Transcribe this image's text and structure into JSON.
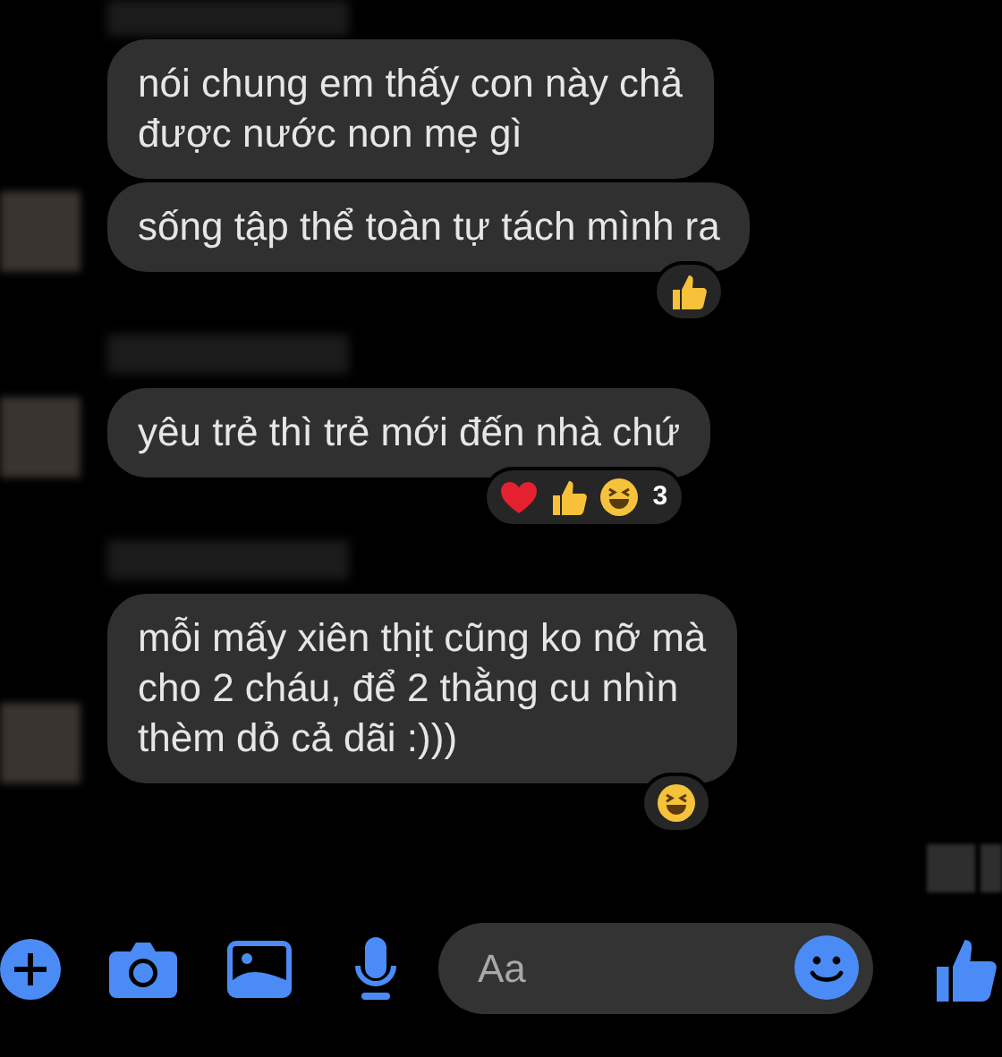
{
  "groups": [
    {
      "messages": [
        {
          "text": "nói chung em thấy con này chả\nđược nước non mẹ gì"
        },
        {
          "text": "sống tập thể toàn tự tách mình ra",
          "reactions": [
            {
              "kind": "like"
            }
          ]
        }
      ]
    },
    {
      "messages": [
        {
          "text": "yêu trẻ thì trẻ mới đến nhà chứ",
          "reactions": [
            {
              "kind": "love"
            },
            {
              "kind": "like"
            },
            {
              "kind": "haha"
            }
          ],
          "reaction_count": "3"
        }
      ]
    },
    {
      "messages": [
        {
          "text": "mỗi mấy xiên thịt cũng ko nỡ mà\ncho 2 cháu, để 2 thằng cu nhìn\nthèm dỏ cả dãi :)))",
          "reactions": [
            {
              "kind": "haha"
            }
          ]
        }
      ]
    }
  ],
  "composer": {
    "placeholder": "Aa"
  }
}
